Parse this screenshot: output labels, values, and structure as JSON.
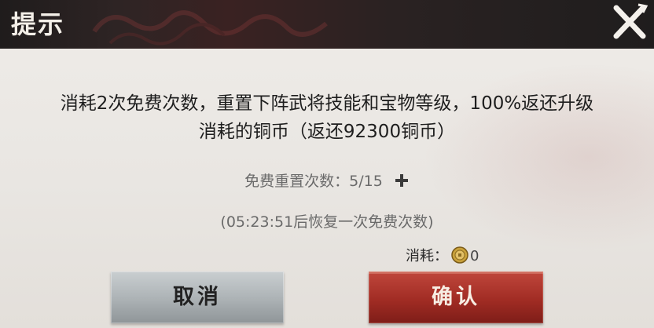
{
  "dialog": {
    "title": "提示",
    "message_line1": "消耗2次免费次数，重置下阵武将技能和宝物等级，100%返还升级",
    "message_line2": "消耗的铜币（返还92300铜币）",
    "free_reset_label": "免费重置次数：",
    "free_reset_count": "5/15",
    "timer_text": "(05:23:51后恢复一次免费次数)",
    "cost_label": "消耗：",
    "cost_value": "0",
    "cancel_label": "取消",
    "confirm_label": "确认"
  },
  "icons": {
    "close": "close-icon",
    "add": "plus-icon",
    "coin": "copper-coin-icon"
  },
  "colors": {
    "title_bar": "#2a2222",
    "cancel_button": "#aeb4b7",
    "confirm_button": "#a12c24",
    "coin": "#c9a13a"
  }
}
